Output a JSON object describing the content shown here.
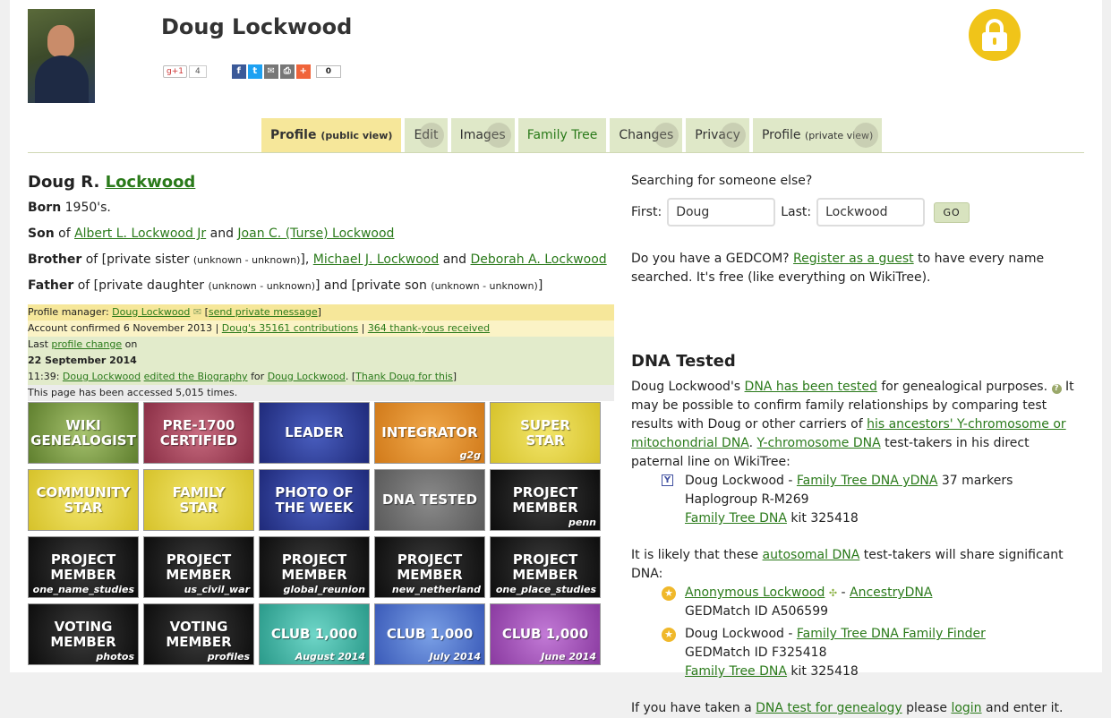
{
  "header": {
    "title": "Doug Lockwood",
    "gplus_label": "g+1",
    "gplus_count": "4",
    "share_count": "0"
  },
  "tabs": [
    {
      "label": "Profile",
      "sub": "(public view)"
    },
    {
      "label": "Edit"
    },
    {
      "label": "Images"
    },
    {
      "label": "Family Tree"
    },
    {
      "label": "Changes"
    },
    {
      "label": "Privacy"
    },
    {
      "label": "Profile",
      "sub": "(private view)"
    }
  ],
  "vitals": {
    "first": "Doug R.",
    "last": "Lockwood",
    "born_label": "Born",
    "born": "1950's.",
    "son_label": "Son",
    "son_of": "of",
    "father_name": "Albert L. Lockwood Jr",
    "and": "and",
    "mother_name": "Joan C. (Turse) Lockwood",
    "brother_label": "Brother",
    "brother_of": "of [private sister",
    "unknown": "(unknown - unknown)",
    "brother_sep": "],",
    "sibling1": "Michael J. Lockwood",
    "sibling2": "Deborah A. Lockwood",
    "father_label": "Father",
    "father_of": "of [private daughter",
    "father_mid": "] and [private son",
    "close": "]"
  },
  "manager": {
    "manager_prefix": "Profile manager:",
    "manager_name": "Doug Lockwood",
    "msg_open": "[",
    "msg_link": "send private message",
    "msg_close": "]",
    "confirmed": "Account confirmed 6 November 2013 |",
    "contributions": "Doug's 35161 contributions",
    "sep": "|",
    "thanks": "364 thank-yous received",
    "last_prefix": "Last",
    "last_link": "profile change",
    "last_on": "on",
    "last_date": "22 September 2014",
    "last_time": "11:39:",
    "last_user": "Doug Lockwood",
    "edited": "edited the Biography",
    "for": "for",
    "for_user": "Doug Lockwood",
    "thank_open": ". [",
    "thank_link": "Thank Doug for this",
    "thank_close": "]",
    "accessed": "This page has been accessed 5,015 times."
  },
  "badges": [
    {
      "l1": "WIKI",
      "l2": "GENEALOGIST",
      "sub": "",
      "color": "bw"
    },
    {
      "l1": "PRE-1700",
      "l2": "CERTIFIED",
      "sub": "",
      "color": "br"
    },
    {
      "l1": "LEADER",
      "l2": "",
      "sub": "",
      "color": "bb"
    },
    {
      "l1": "INTEGRATOR",
      "l2": "",
      "sub": "g2g",
      "color": "bo"
    },
    {
      "l1": "SUPER",
      "l2": "STAR",
      "sub": "",
      "color": "by"
    },
    {
      "l1": "COMMUNITY",
      "l2": "STAR",
      "sub": "",
      "color": "by"
    },
    {
      "l1": "FAMILY",
      "l2": "STAR",
      "sub": "",
      "color": "by"
    },
    {
      "l1": "PHOTO OF",
      "l2": "THE WEEK",
      "sub": "",
      "color": "bb"
    },
    {
      "l1": "DNA TESTED",
      "l2": "",
      "sub": "",
      "color": "bg"
    },
    {
      "l1": "PROJECT",
      "l2": "MEMBER",
      "sub": "penn",
      "color": "bk"
    },
    {
      "l1": "PROJECT",
      "l2": "MEMBER",
      "sub": "one_name_studies",
      "color": "bk"
    },
    {
      "l1": "PROJECT",
      "l2": "MEMBER",
      "sub": "us_civil_war",
      "color": "bk"
    },
    {
      "l1": "PROJECT",
      "l2": "MEMBER",
      "sub": "global_reunion",
      "color": "bk"
    },
    {
      "l1": "PROJECT",
      "l2": "MEMBER",
      "sub": "new_netherland",
      "color": "bk"
    },
    {
      "l1": "PROJECT",
      "l2": "MEMBER",
      "sub": "one_place_studies",
      "color": "bk"
    },
    {
      "l1": "VOTING",
      "l2": "MEMBER",
      "sub": "photos",
      "color": "bk"
    },
    {
      "l1": "VOTING",
      "l2": "MEMBER",
      "sub": "profiles",
      "color": "bk"
    },
    {
      "l1": "CLUB 1,000",
      "l2": "",
      "sub": "August 2014",
      "color": "bt"
    },
    {
      "l1": "CLUB 1,000",
      "l2": "",
      "sub": "July 2014",
      "color": "bl"
    },
    {
      "l1": "CLUB 1,000",
      "l2": "",
      "sub": "June 2014",
      "color": "bp"
    }
  ],
  "search": {
    "heading": "Searching for someone else?",
    "first_label": "First:",
    "first_value": "Doug",
    "last_label": "Last:",
    "last_value": "Lockwood",
    "go": "GO",
    "gedcom_q": "Do you have a GEDCOM?",
    "gedcom_link": "Register as a guest",
    "gedcom_rest": "to have every name searched.",
    "gedcom_free": "It's free (like everything on WikiTree)."
  },
  "dna": {
    "heading": "DNA Tested",
    "intro1": "Doug Lockwood's",
    "intro_link": "DNA has been tested",
    "intro2": "for genealogical purposes.",
    "intro3": "It may be possible to confirm family relationships by comparing test results with Doug or other carriers of",
    "ancestors_link": "his ancestors' Y-chromosome or mitochondrial DNA",
    "dot": ".",
    "y_link": "Y-chromosome DNA",
    "y_rest": "test-takers in his direct paternal line on WikiTree:",
    "y1_name": "Doug Lockwood -",
    "y1_link": "Family Tree DNA yDNA",
    "y1_markers": "37 markers",
    "y1_haplo": "Haplogroup R-M269",
    "y1_kit_link": "Family Tree DNA",
    "y1_kit": "kit 325418",
    "auto_pre": "It is likely that these",
    "auto_link": "autosomal DNA",
    "auto_rest": "test-takers will share significant DNA:",
    "a1_link": "Anonymous Lockwood",
    "a1_dash": "-",
    "a1_src": "AncestryDNA",
    "a1_ged": "GEDMatch ID A506599",
    "a2_name": "Doug Lockwood -",
    "a2_link": "Family Tree DNA Family Finder",
    "a2_ged": "GEDMatch ID F325418",
    "a2_kit_link": "Family Tree DNA",
    "a2_kit": "kit 325418",
    "taken_pre": "If you have taken a",
    "taken_link": "DNA test for genealogy",
    "taken_mid": "please",
    "taken_login": "login",
    "taken_rest": "and enter it."
  }
}
